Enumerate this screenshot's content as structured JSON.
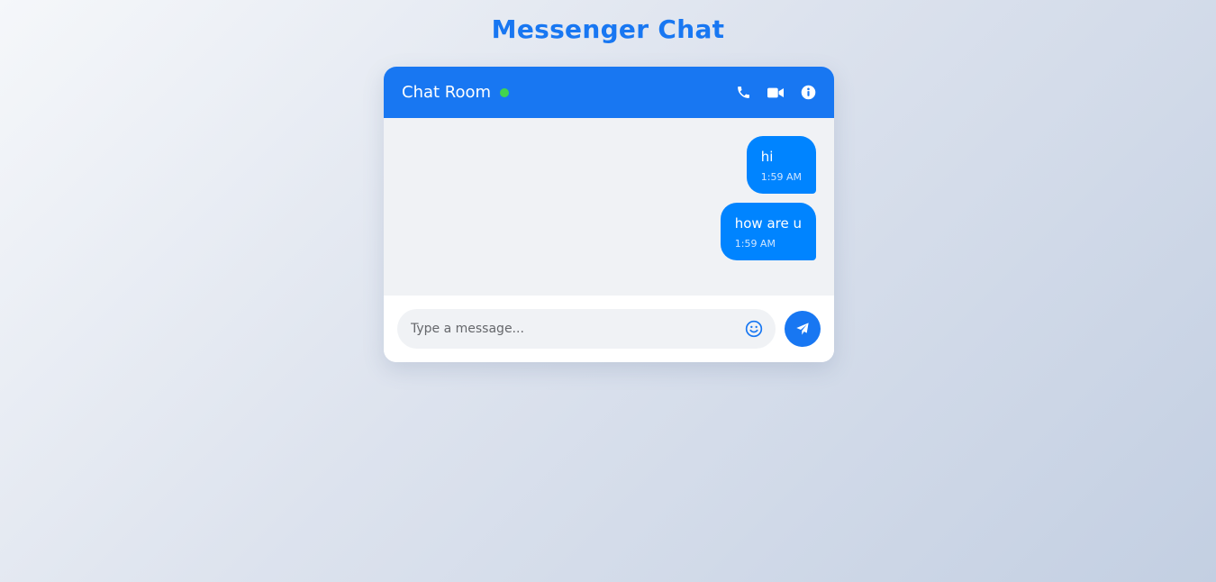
{
  "app": {
    "title": "Messenger Chat"
  },
  "header": {
    "room_name": "Chat Room",
    "status": "online",
    "actions": [
      {
        "icon": "phone-icon",
        "label": ""
      },
      {
        "icon": "video-camera-icon",
        "label": ""
      },
      {
        "icon": "info-icon",
        "label": ""
      }
    ]
  },
  "messages": [
    {
      "text": "hi",
      "time": "1:59 AM",
      "sender": "me"
    },
    {
      "text": "how are u",
      "time": "1:59 AM",
      "sender": "me"
    }
  ],
  "composer": {
    "placeholder": "Type a message...",
    "value": ""
  },
  "colors": {
    "brand": "#1877f2",
    "bubble": "#0084ff",
    "online": "#42d44f",
    "chat_bg": "#f0f2f5"
  }
}
